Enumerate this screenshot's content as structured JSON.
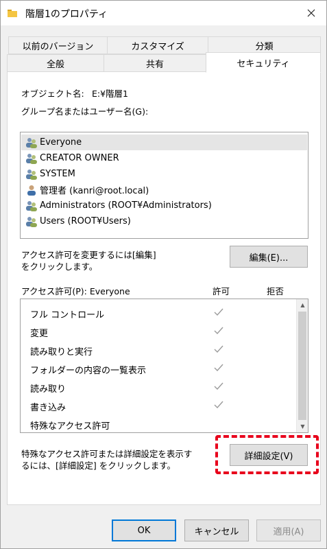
{
  "window": {
    "title": "階層1のプロパティ"
  },
  "tabs": {
    "row_top": [
      "以前のバージョン",
      "カスタマイズ",
      "分類"
    ],
    "row_bottom": [
      "全般",
      "共有",
      "セキュリティ"
    ]
  },
  "security": {
    "object_name_label": "オブジェクト名:",
    "object_name_value": "E:¥階層1",
    "group_label": "グループ名またはユーザー名(G):",
    "principals": [
      "Everyone",
      "CREATOR OWNER",
      "SYSTEM",
      "管理者 (kanri@root.local)",
      "Administrators (ROOT¥Administrators)",
      "Users (ROOT¥Users)"
    ],
    "edit_hint_1": "アクセス許可を変更するには[編集]",
    "edit_hint_2": "をクリックします。",
    "edit_button": "編集(E)...",
    "perm_label": "アクセス許可(P): Everyone",
    "allow_header": "許可",
    "deny_header": "拒否",
    "permissions": [
      "フル コントロール",
      "変更",
      "読み取りと実行",
      "フォルダーの内容の一覧表示",
      "読み取り",
      "書き込み",
      "特殊なアクセス許可"
    ],
    "permission_allowed": [
      true,
      true,
      true,
      true,
      true,
      true,
      false
    ],
    "advanced_hint_1": "特殊なアクセス許可または詳細設定を表示す",
    "advanced_hint_2": "るには、[詳細設定] をクリックします。",
    "advanced_button": "詳細設定(V)"
  },
  "footer": {
    "ok": "OK",
    "cancel": "キャンセル",
    "apply": "適用(A)"
  },
  "colors": {
    "highlight": "#e8001c",
    "check": "#9a9a9a",
    "selected_row": "#e5e5e5"
  }
}
